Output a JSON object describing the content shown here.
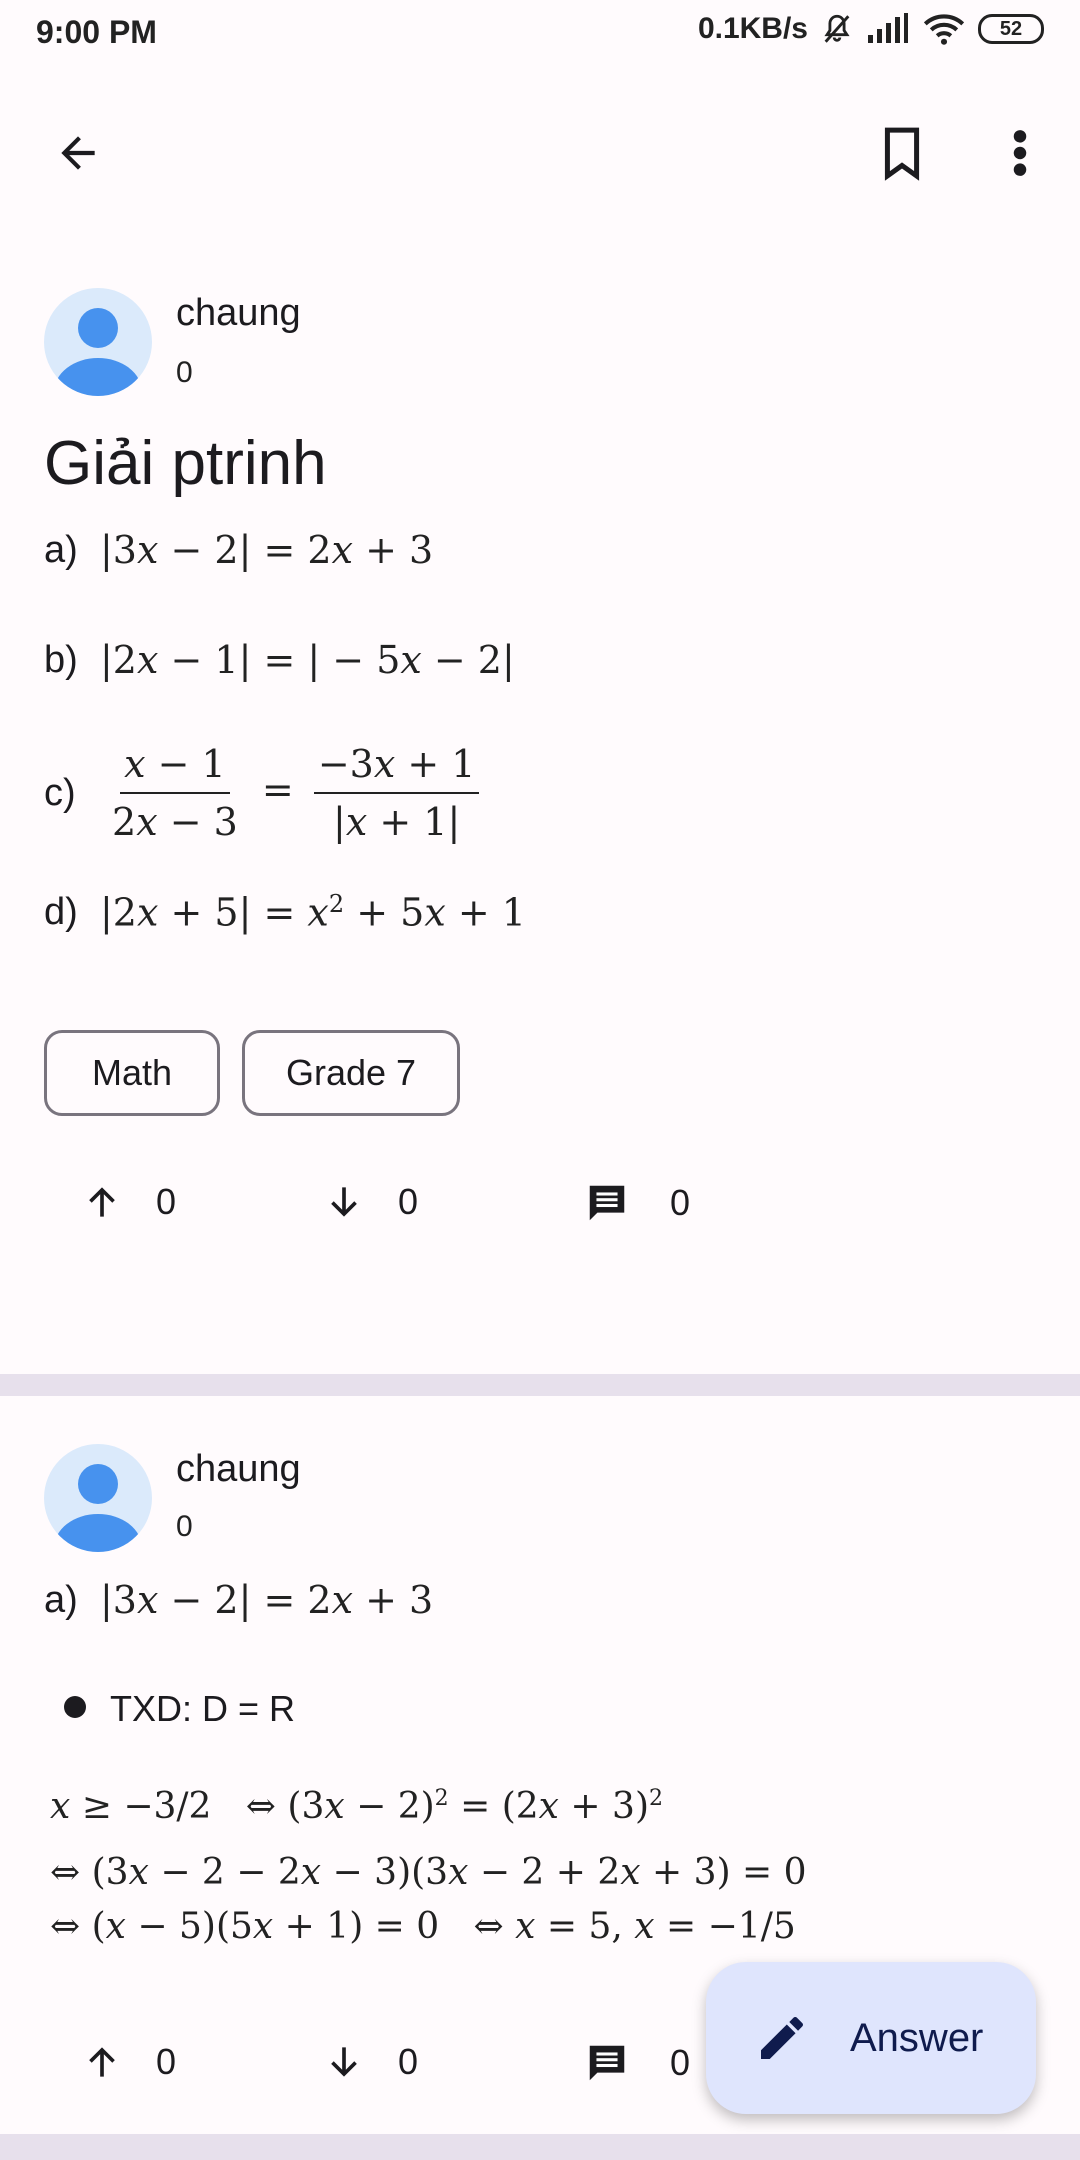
{
  "status_bar": {
    "time": "9:00 PM",
    "speed": "0.1KB/s",
    "battery": "52"
  },
  "question": {
    "author": "chaung",
    "score": "0",
    "title": "Giải ptrinh",
    "problems": [
      {
        "label": "a)"
      },
      {
        "label": "b)"
      },
      {
        "label": "c)"
      },
      {
        "label": "d)"
      }
    ],
    "tags": [
      "Math",
      "Grade 7"
    ],
    "upvotes": "0",
    "downvotes": "0",
    "comments": "0"
  },
  "answer": {
    "author": "chaung",
    "score": "0",
    "problem_label": "a)",
    "bullet_text": "TXD: D = R",
    "upvotes": "0",
    "downvotes": "0",
    "comments": "0"
  },
  "fab": {
    "label": "Answer"
  },
  "colors": {
    "accent": "#4a90e2",
    "fab_bg": "#dfe5fd",
    "divider": "#e7e0ec"
  }
}
